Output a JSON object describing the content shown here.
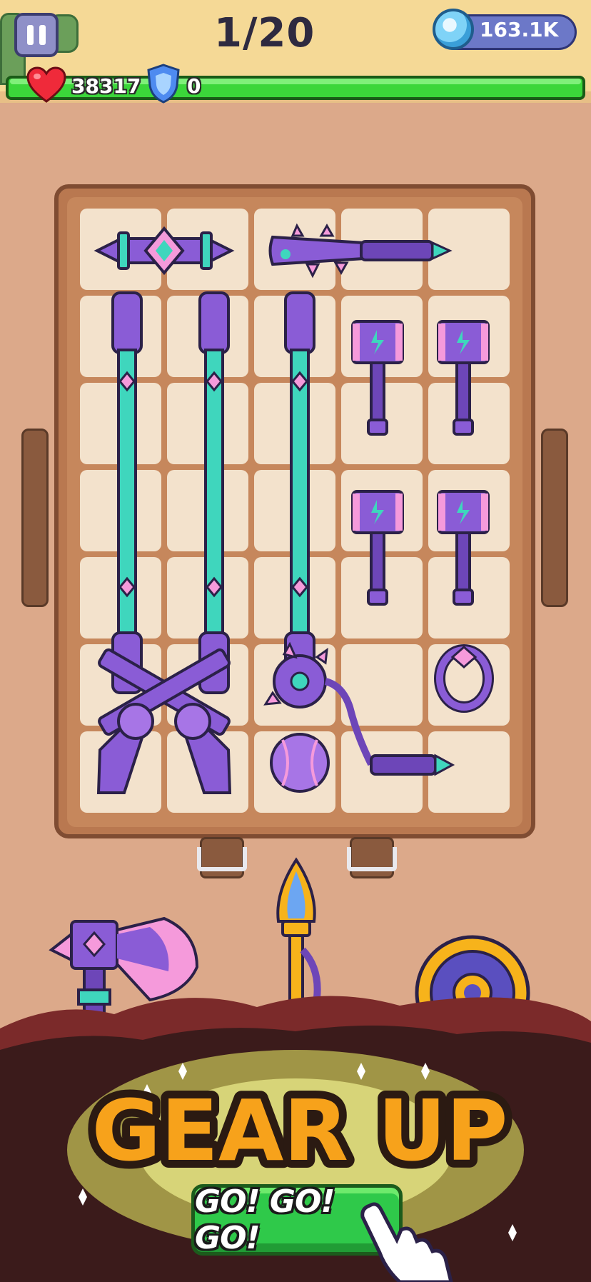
{
  "hud": {
    "level_text": "1/20",
    "gems": "163.1K",
    "health": "38317",
    "shield": "0",
    "pause_icon": "pause-icon",
    "gem_icon": "gem-icon",
    "heart_icon": "heart-icon",
    "shield_icon": "shield-icon"
  },
  "inventory": {
    "items": [
      {
        "name": "gem-sword-item"
      },
      {
        "name": "spiked-bat-item"
      },
      {
        "name": "staff-item"
      },
      {
        "name": "staff-item"
      },
      {
        "name": "staff-item"
      },
      {
        "name": "lightning-hammer-item"
      },
      {
        "name": "lightning-hammer-item"
      },
      {
        "name": "lightning-hammer-item"
      },
      {
        "name": "lightning-hammer-item"
      },
      {
        "name": "crossed-revolvers-item"
      },
      {
        "name": "spiked-flail-item"
      },
      {
        "name": "ring-item"
      },
      {
        "name": "baseball-item"
      }
    ]
  },
  "rewards": [
    {
      "name": "battle-axe-item"
    },
    {
      "name": "golden-torch-item"
    },
    {
      "name": "golden-shield-item"
    }
  ],
  "banner": {
    "title": "GEAR UP",
    "button_label": "GO! GO! GO!"
  },
  "colors": {
    "purple": "#8a5cd6",
    "teal": "#3fd6bd",
    "pink": "#f59adb",
    "gold": "#f7b31b",
    "green": "#2fc94a"
  }
}
